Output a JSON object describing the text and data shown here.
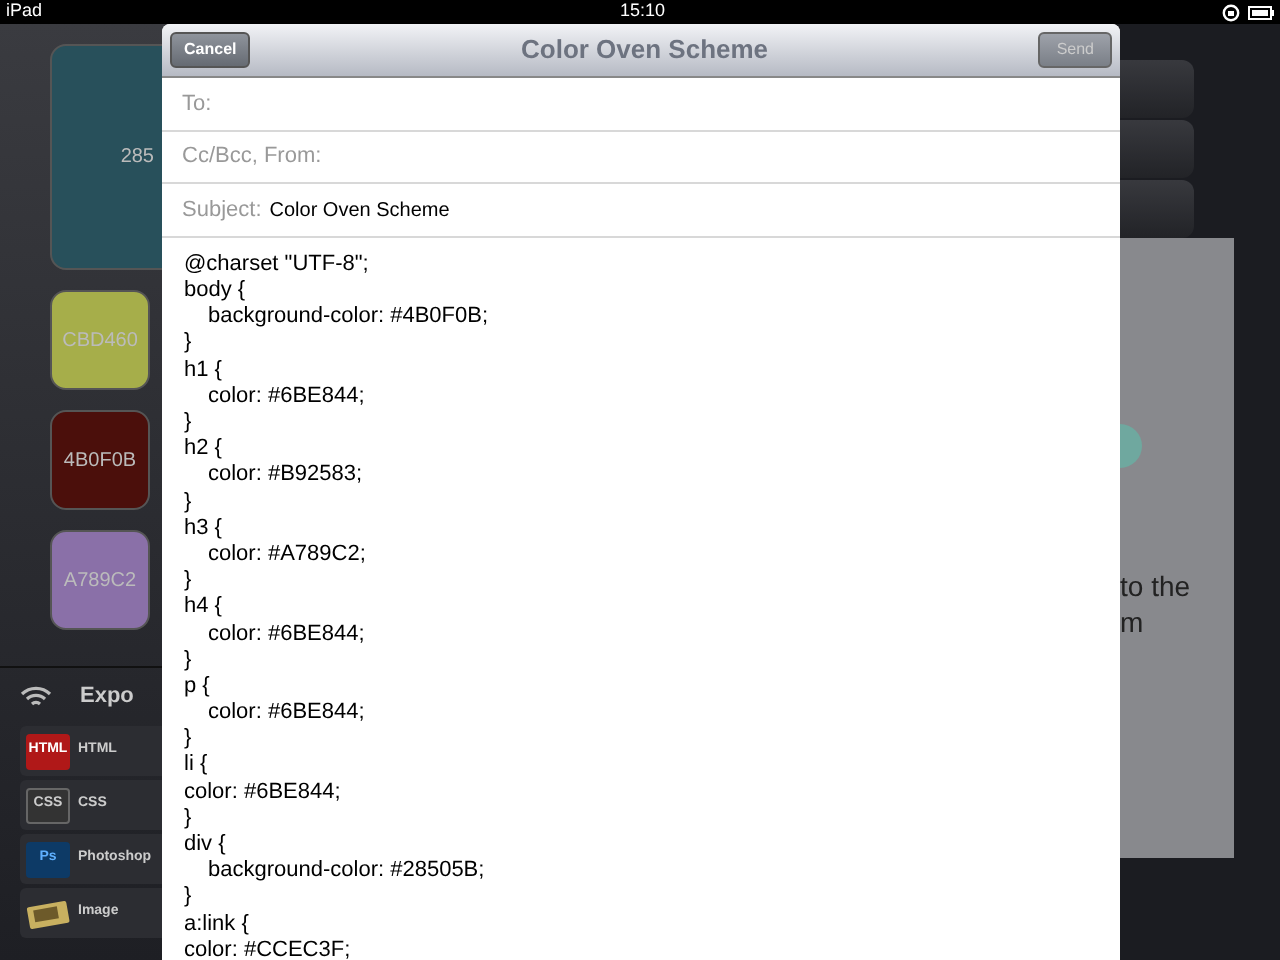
{
  "status_bar": {
    "device": "iPad",
    "time": "15:10"
  },
  "swatches": [
    {
      "label": "285",
      "color": "#28505b",
      "kind": "large"
    },
    {
      "label": "CBD460",
      "color": "#a6ae4a",
      "kind": "small"
    },
    {
      "label": "4B0F0B",
      "color": "#4b0f0b",
      "kind": "small"
    },
    {
      "label": "A789C2",
      "color": "#8a70a8",
      "kind": "small"
    }
  ],
  "export": {
    "title": "Expo",
    "items": [
      {
        "kind": "html",
        "badge": "HTML",
        "label": "HTML"
      },
      {
        "kind": "css",
        "badge": "CSS",
        "label": "CSS"
      },
      {
        "kind": "ps",
        "badge": "Ps",
        "label": "Photoshop"
      },
      {
        "kind": "image",
        "label": "Image"
      }
    ]
  },
  "preview": {
    "lines": [
      "to the",
      "m"
    ]
  },
  "mail": {
    "title": "Color Oven Scheme",
    "cancel": "Cancel",
    "send": "Send",
    "fields": [
      {
        "label": "To:"
      },
      {
        "label": "Cc/Bcc, From:"
      },
      {
        "label": "Subject:",
        "value": "Color Oven Scheme"
      }
    ],
    "body": [
      {
        "text": "@charset \"UTF-8\";",
        "indented": false
      },
      {
        "text": "body {",
        "indented": false
      },
      {
        "text": "background-color: #4B0F0B;",
        "indented": true
      },
      {
        "text": "}",
        "indented": false
      },
      {
        "text": "h1 {",
        "indented": false
      },
      {
        "text": "color: #6BE844;",
        "indented": true
      },
      {
        "text": "}",
        "indented": false
      },
      {
        "text": "h2 {",
        "indented": false
      },
      {
        "text": "color: #B92583;",
        "indented": true
      },
      {
        "text": "}",
        "indented": false
      },
      {
        "text": "h3 {",
        "indented": false
      },
      {
        "text": "color: #A789C2;",
        "indented": true
      },
      {
        "text": "}",
        "indented": false
      },
      {
        "text": "h4 {",
        "indented": false
      },
      {
        "text": "color: #6BE844;",
        "indented": true
      },
      {
        "text": "}",
        "indented": false
      },
      {
        "text": "p {",
        "indented": false
      },
      {
        "text": "color: #6BE844;",
        "indented": true
      },
      {
        "text": "}",
        "indented": false
      },
      {
        "text": "li {",
        "indented": false
      },
      {
        "text": "color: #6BE844;",
        "indented": false
      },
      {
        "text": "}",
        "indented": false
      },
      {
        "text": "div {",
        "indented": false
      },
      {
        "text": "background-color: #28505B;",
        "indented": true
      },
      {
        "text": "}",
        "indented": false
      },
      {
        "text": "a:link {",
        "indented": false
      },
      {
        "text": "color: #CCEC3F;",
        "indented": false
      }
    ]
  }
}
